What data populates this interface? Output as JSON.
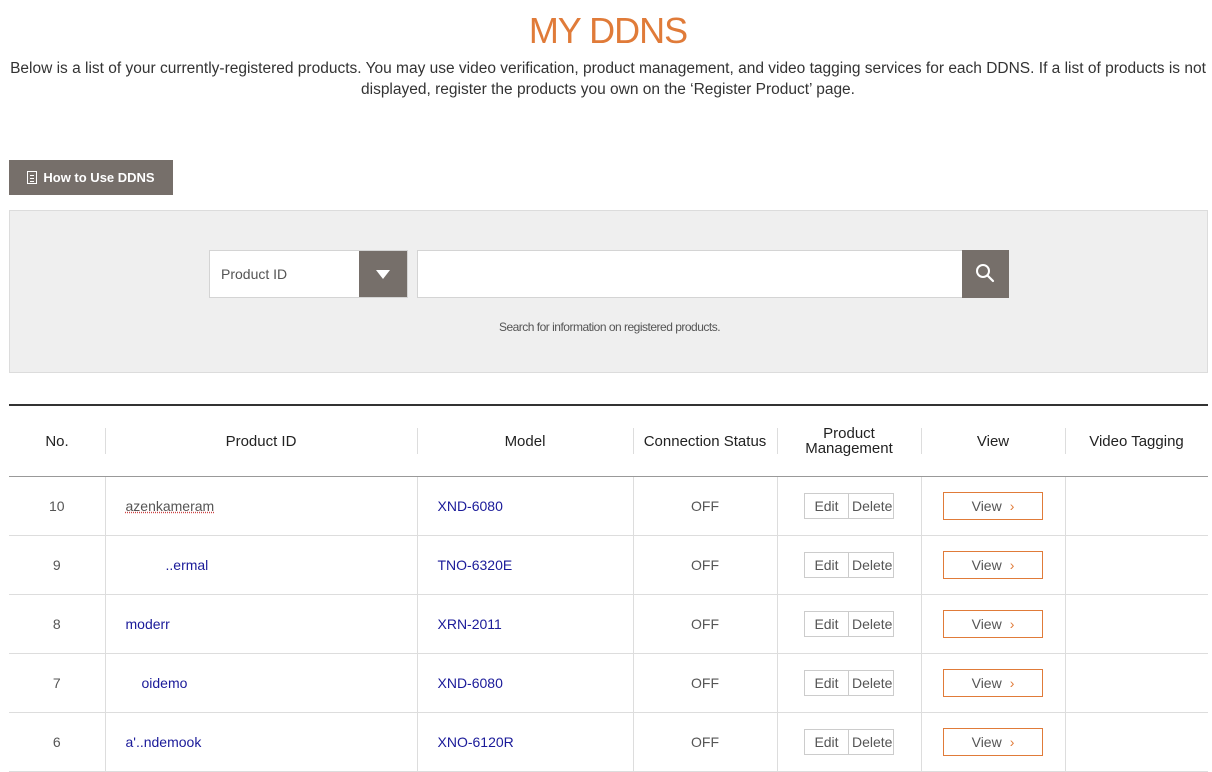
{
  "page": {
    "title": "MY DDNS",
    "intro": "Below is a list of your currently-registered products. You may use video verification, product management, and video tagging services for each DDNS. If a list of products is not displayed, register the products you own on the ‘Register Product’ page."
  },
  "toolbar": {
    "howto_label": "How to Use DDNS"
  },
  "search": {
    "select_value": "Product ID",
    "input_value": "",
    "hint": "Search for information on registered products."
  },
  "table": {
    "headers": {
      "no": "No.",
      "product_id": "Product ID",
      "model": "Model",
      "status": "Connection Status",
      "mgmt": "Product Management",
      "view": "View",
      "tagging": "Video Tagging"
    },
    "edit_label": "Edit",
    "delete_label": "Delete",
    "view_label": "View",
    "rows": [
      {
        "no": "10",
        "product_id": "azenkameram",
        "model": "XND-6080",
        "status": "OFF"
      },
      {
        "no": "9",
        "product_id": "..ermal",
        "model": "TNO-6320E",
        "status": "OFF"
      },
      {
        "no": "8",
        "product_id": "moderr",
        "model": "XRN-2011",
        "status": "OFF"
      },
      {
        "no": "7",
        "product_id": "oidemo",
        "model": "XND-6080",
        "status": "OFF"
      },
      {
        "no": "6",
        "product_id": "a'..ndemook",
        "model": "XNO-6120R",
        "status": "OFF"
      }
    ]
  },
  "colors": {
    "accent": "#e07b39",
    "button_gray": "#766f6a",
    "link_blue": "#1a1a99"
  },
  "icons": {
    "howto": "document-icon",
    "select": "caret-down-icon",
    "search": "magnifier-icon",
    "view": "chevron-right-icon"
  }
}
